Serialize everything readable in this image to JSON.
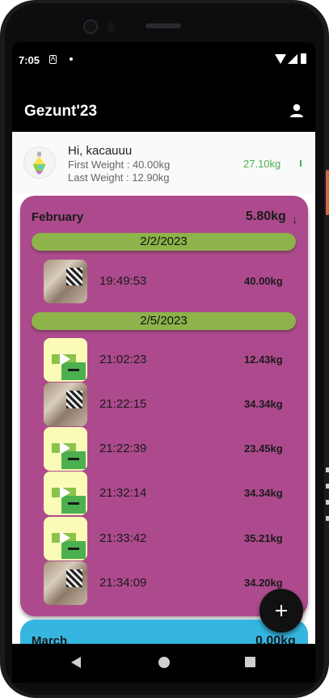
{
  "status_bar": {
    "time": "7:05",
    "notification_glyph": "A"
  },
  "app_bar": {
    "title": "Gezunt'23"
  },
  "user": {
    "greeting": "Hi, kacauuu",
    "first_weight": "First Weight : 40.00kg",
    "last_weight": "Last Weight : 12.90kg",
    "current_weight": "27.10kg"
  },
  "months": [
    {
      "name": "February",
      "total": "5.80kg",
      "total_arrow": "↓",
      "color": "#ad4a8d",
      "days": [
        {
          "date": "2/2/2023",
          "entries": [
            {
              "time": "19:49:53",
              "weight": "40.00kg",
              "media": "photo"
            }
          ]
        },
        {
          "date": "2/5/2023",
          "entries": [
            {
              "time": "21:02:23",
              "weight": "12.43kg",
              "media": "video"
            },
            {
              "time": "21:22:15",
              "weight": "34.34kg",
              "media": "photo"
            },
            {
              "time": "21:22:39",
              "weight": "23.45kg",
              "media": "video"
            },
            {
              "time": "21:32:14",
              "weight": "34.34kg",
              "media": "video"
            },
            {
              "time": "21:33:42",
              "weight": "35.21kg",
              "media": "video"
            },
            {
              "time": "21:34:09",
              "weight": "34.20kg",
              "media": "photo"
            }
          ]
        }
      ]
    },
    {
      "name": "March",
      "total": "0.00kg",
      "color": "#35b6e0"
    }
  ],
  "colors": {
    "date_pill": "#8db34a",
    "weight_positive": "#4caf50"
  },
  "icons": {
    "profile": "person-icon",
    "avatar": "lightbulb-icon",
    "fab": "plus-icon",
    "video": "play-icon",
    "nav": [
      "back-icon",
      "home-icon",
      "recents-icon"
    ]
  }
}
